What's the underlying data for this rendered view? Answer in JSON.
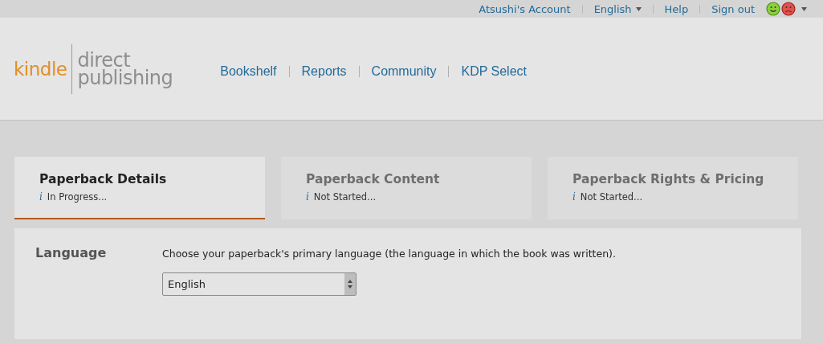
{
  "top_bar": {
    "links": [
      {
        "label": "Atsushi's Account",
        "dropdown": false
      },
      {
        "label": "English",
        "dropdown": true
      },
      {
        "label": "Help",
        "dropdown": false
      },
      {
        "label": "Sign out",
        "dropdown": false
      }
    ]
  },
  "logo": {
    "brand": "kindle",
    "line_1": "direct",
    "line_2": "publishing"
  },
  "nav": [
    "Bookshelf",
    "Reports",
    "Community",
    "KDP Select"
  ],
  "steps": [
    {
      "title": "Paperback Details",
      "info_icon": "i",
      "status": "In Progress...",
      "selected": true
    },
    {
      "title": "Paperback Content",
      "info_icon": "i",
      "status": "Not Started...",
      "selected": false
    },
    {
      "title": "Paperback Rights & Pricing",
      "info_icon": "i",
      "status": "Not Started...",
      "selected": false
    }
  ],
  "section": {
    "label": "Language",
    "description": "Choose your paperback's primary language (the language in which the book was written).",
    "select_value": "English"
  }
}
